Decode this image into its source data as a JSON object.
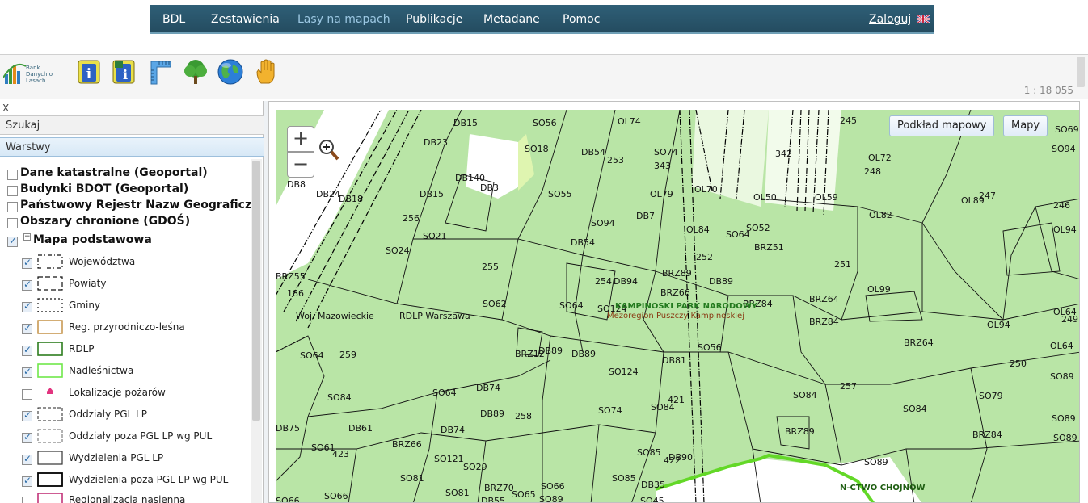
{
  "nav": {
    "items": [
      "BDL",
      "Zestawienia",
      "Lasy na mapach",
      "Publikacje",
      "Metadane",
      "Pomoc"
    ],
    "active": "Lasy na mapach",
    "login": "Zaloguj",
    "flag_icon": "uk-flag-icon"
  },
  "toolbar": {
    "logo_text": "Bank Danych o Lasach",
    "tools": [
      "bdl-logo-icon",
      "info-icon",
      "info-map-icon",
      "measure-icon",
      "tree-icon",
      "globe-icon",
      "pan-hand-icon"
    ],
    "scale": "1 : 18 055"
  },
  "panel": {
    "close_label": "X",
    "search_label": "Szukaj",
    "layers_label": "Warstwy",
    "top_layers": [
      {
        "label": "Dane katastralne (Geoportal)",
        "checked": false
      },
      {
        "label": "Budynki BDOT (Geoportal)",
        "checked": false
      },
      {
        "label": "Państwowy Rejestr Nazw Geograficznych",
        "checked": false
      },
      {
        "label": "Obszary chronione (GDOŚ)",
        "checked": false
      }
    ],
    "group": {
      "label": "Mapa podstawowa",
      "checked": true,
      "expander": "−"
    },
    "sublayers": [
      {
        "label": "Województwa",
        "checked": true
      },
      {
        "label": "Powiaty",
        "checked": true
      },
      {
        "label": "Gminy",
        "checked": true
      },
      {
        "label": "Reg. przyrodniczo-leśna",
        "checked": true
      },
      {
        "label": "RDLP",
        "checked": true
      },
      {
        "label": "Nadleśnictwa",
        "checked": true
      },
      {
        "label": "Lokalizacje pożarów",
        "checked": false
      },
      {
        "label": "Oddziały PGL LP",
        "checked": true
      },
      {
        "label": "Oddziały poza PGL LP wg PUL",
        "checked": true
      },
      {
        "label": "Wydzielenia PGL LP",
        "checked": true
      },
      {
        "label": "Wydzielenia poza PGL LP wg PUL",
        "checked": true
      },
      {
        "label": "Regionalizacja nasienna",
        "checked": false
      }
    ]
  },
  "map": {
    "zoom_in": "+",
    "zoom_out": "−",
    "basemap_button": "Podkład mapowy",
    "maps_button": "Mapy",
    "labels": {
      "woj": "Woj. Mazowieckie",
      "rdlp": "RDLP Warszawa",
      "park": "KAMPINOSKI PARK NARODOWY",
      "region": "Mezoregion Puszczy Kampinoskiej",
      "nadl": "N-CTWO CHOJNÓW",
      "compartments": [
        "245",
        "253",
        "343",
        "342",
        "248",
        "247",
        "246",
        "256",
        "255",
        "252",
        "251",
        "254",
        "186",
        "259",
        "249",
        "250",
        "257",
        "258",
        "421",
        "423",
        "422"
      ],
      "subdivisions": [
        "SO56",
        "OL74",
        "DB15",
        "DB23",
        "SO18",
        "DB54",
        "SO74",
        "OL72",
        "SO94",
        "SO69",
        "DB140",
        "DB3",
        "SO55",
        "OL79",
        "OL70",
        "OL50",
        "OL59",
        "OL82",
        "OL89",
        "DB8",
        "DB24",
        "DB18",
        "DB15",
        "SO94",
        "DB7",
        "OL84",
        "SO64",
        "SO52",
        "SO21",
        "DB54",
        "BRZ51",
        "SO24",
        "BRZ89",
        "DB89",
        "OL94",
        "BRZ55",
        "SO62",
        "DB94",
        "SO64",
        "SO124",
        "BRZ66",
        "BRZ84",
        "BRZ64",
        "OL99",
        "OL64",
        "BRZ84",
        "OL94",
        "SO64",
        "BRZ12",
        "DB89",
        "DB89",
        "SO56",
        "DB81",
        "SO124",
        "BRZ64",
        "OL64",
        "SO89",
        "SO84",
        "DB74",
        "SO64",
        "DB89",
        "SO84",
        "SO74",
        "SO84",
        "SO84",
        "SO89",
        "SO79",
        "BRZ89",
        "BRZ84",
        "DB75",
        "DB61",
        "DB74",
        "SO89",
        "SO61",
        "BRZ66",
        "SO121",
        "SO29",
        "SO85",
        "DB90",
        "SO89",
        "SO66",
        "SO81",
        "SO81",
        "BRZ70",
        "SO65",
        "SO89",
        "SO85",
        "DB35",
        "SO45",
        "SO66",
        "DB55",
        "SO66"
      ]
    }
  }
}
